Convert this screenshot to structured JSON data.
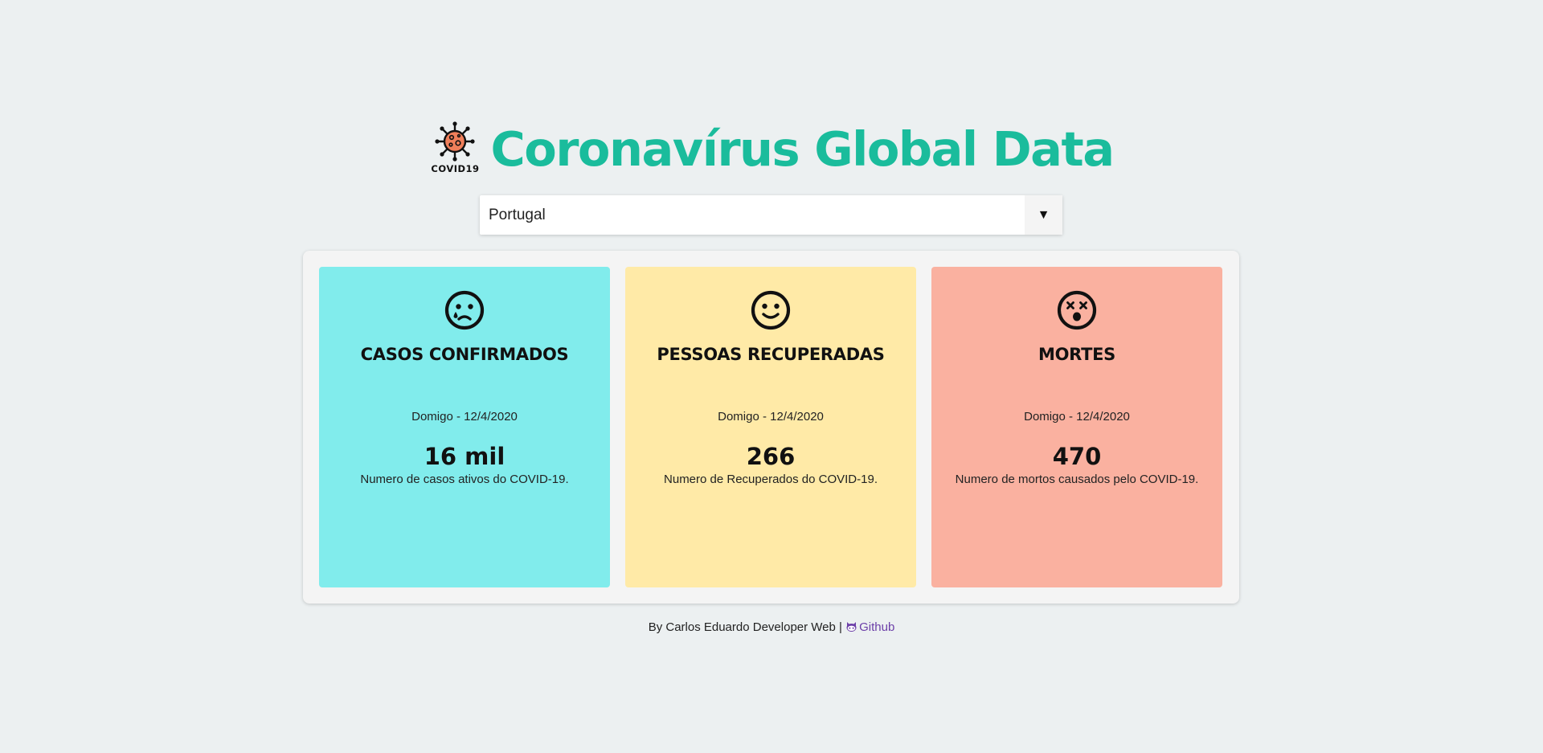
{
  "header": {
    "logo_text": "COVID19",
    "title": "Coronavírus Global Data"
  },
  "country_select": {
    "selected": "Portugal",
    "arrow": "▼"
  },
  "cards": [
    {
      "icon": "sad-tear-face-icon",
      "title": "CASOS CONFIRMADOS",
      "date": "Domigo - 12/4/2020",
      "value": "16 mil",
      "description": "Numero de casos ativos do COVID-19.",
      "color": "#81ecec"
    },
    {
      "icon": "smile-face-icon",
      "title": "PESSOAS RECUPERADAS",
      "date": "Domigo - 12/4/2020",
      "value": "266",
      "description": "Numero de Recuperados do COVID-19.",
      "color": "#ffeaa7"
    },
    {
      "icon": "dizzy-face-icon",
      "title": "MORTES",
      "date": "Domigo - 12/4/2020",
      "value": "470",
      "description": "Numero de mortos causados pelo COVID-19.",
      "color": "#fab1a0"
    }
  ],
  "footer": {
    "credit": "By Carlos Eduardo Developer Web |",
    "link_icon": "github-icon",
    "link_label": "Github"
  },
  "colors": {
    "background": "#ecf0f1",
    "title": "#1abc9c",
    "virus": "#f07f5a",
    "link": "#6c3fa8"
  }
}
